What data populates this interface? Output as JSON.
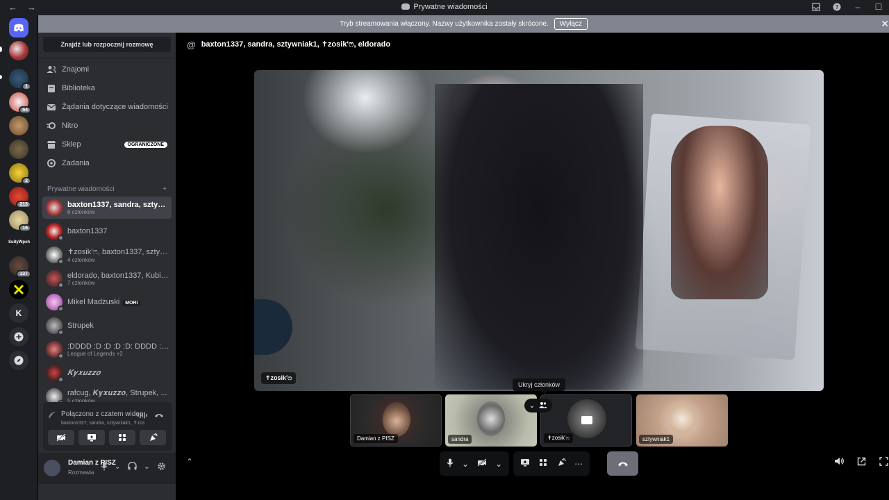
{
  "window": {
    "title": "Prywatne wiadomości"
  },
  "banner": {
    "text": "Tryb streamowania włączony. Nazwy użytkownika zostały skrócone.",
    "button": "Wyłącz"
  },
  "servers": [
    {
      "badge": ""
    },
    {
      "badge": "1"
    },
    {
      "badge": "54"
    },
    {
      "badge": ""
    },
    {
      "badge": ""
    },
    {
      "badge": "2"
    },
    {
      "badge": "213"
    },
    {
      "badge": "16"
    },
    {
      "badge": "137"
    }
  ],
  "server_tag": "SuityWpsh",
  "server_letter": "K",
  "sidebar": {
    "search": "Znajdź lub rozpocznij rozmowę",
    "nav": [
      {
        "label": "Znajomi"
      },
      {
        "label": "Biblioteka"
      },
      {
        "label": "Żądania dotyczące wiadomości"
      },
      {
        "label": "Nitro"
      },
      {
        "label": "Sklep",
        "chip": "OGRANICZONE"
      },
      {
        "label": "Zadania"
      }
    ],
    "dm_header": "Prywatne wiadomości",
    "dm_add": "+",
    "dms": [
      {
        "name": "baxton1337, sandra, sztywniak1...",
        "sub": "6 członków"
      },
      {
        "name": "baxton1337",
        "sub": ""
      },
      {
        "name": "✝zosik'ෆ, baxton1337, sztywn...",
        "sub": "4 członków"
      },
      {
        "name": "eldorado, baxton1337, Kubi, sz...",
        "sub": "7 członków"
      },
      {
        "name": "Mikel Madżuski",
        "sub": "",
        "chip": "MORI"
      },
      {
        "name": "Strupek",
        "sub": ""
      },
      {
        "name": ":DDDD :D :D :D :D: DDDD :DD...",
        "sub": "League of Legends +2"
      },
      {
        "name": "𝑲𝒚𝒙𝒖𝒛𝒛𝒐",
        "sub": ""
      },
      {
        "name": "rafcug, 𝑲𝒚𝒙𝒖𝒛𝒛𝒐, Strupek, ...",
        "sub": "5 członków"
      }
    ]
  },
  "voice": {
    "title": "Połączono z czatem wideo",
    "sub": "baxton1337, sandra, sztywniak1, ✝zosi..."
  },
  "user": {
    "name": "Damian z PISZ",
    "status": "Rozmawia"
  },
  "header": {
    "title": "baxton1337, sandra, sztywniak1, ✝zosik'ෆ, eldorado"
  },
  "main_video": {
    "name": "✝zosik'ෆ"
  },
  "tooltip": "Ukryj członków",
  "thumbnails": [
    {
      "name": "Damian z PISZ"
    },
    {
      "name": "sandra"
    },
    {
      "name": "✝zosik'ෆ"
    },
    {
      "name": "sztywniak1"
    }
  ],
  "colors": {
    "brand": "#5865f2",
    "sidebar": "#2b2d31",
    "rail": "#1e1f22",
    "banner": "#80848e"
  }
}
